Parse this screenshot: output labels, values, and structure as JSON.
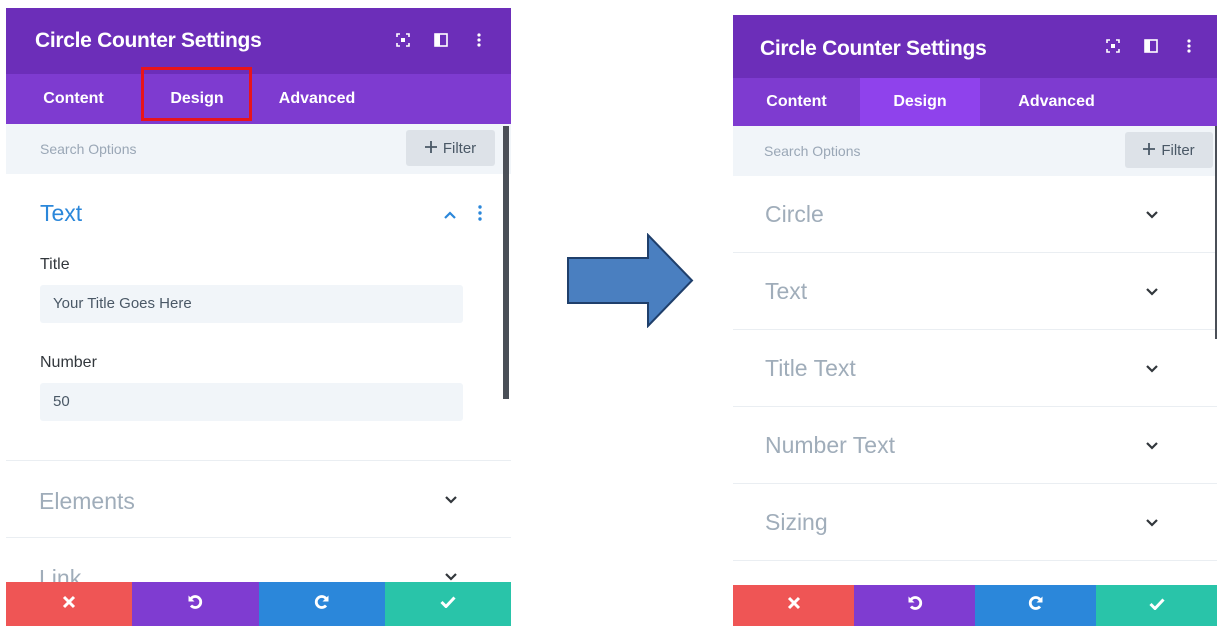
{
  "left_panel": {
    "title": "Circle Counter Settings",
    "header_icons": [
      "focus-icon",
      "columns-icon",
      "more-vertical-icon"
    ],
    "tabs": [
      {
        "label": "Content",
        "active": true
      },
      {
        "label": "Design",
        "active": false,
        "highlighted": true
      },
      {
        "label": "Advanced",
        "active": false
      }
    ],
    "search": {
      "placeholder": "Search Options",
      "filter_label": "Filter"
    },
    "open_section": {
      "label": "Text",
      "fields": [
        {
          "label": "Title",
          "value": "Your Title Goes Here"
        },
        {
          "label": "Number",
          "value": "50"
        }
      ]
    },
    "sections": [
      {
        "label": "Elements"
      },
      {
        "label": "Link"
      }
    ]
  },
  "right_panel": {
    "title": "Circle Counter Settings",
    "header_icons": [
      "focus-icon",
      "columns-icon",
      "more-vertical-icon"
    ],
    "tabs": [
      {
        "label": "Content",
        "active": false
      },
      {
        "label": "Design",
        "active": true
      },
      {
        "label": "Advanced",
        "active": false
      }
    ],
    "search": {
      "placeholder": "Search Options",
      "filter_label": "Filter"
    },
    "sections": [
      {
        "label": "Circle"
      },
      {
        "label": "Text"
      },
      {
        "label": "Title Text"
      },
      {
        "label": "Number Text"
      },
      {
        "label": "Sizing"
      }
    ]
  },
  "footer_icons": [
    "close-icon",
    "undo-icon",
    "redo-icon",
    "check-icon"
  ],
  "colors": {
    "header": "#6c2eb9",
    "tabs": "#7e3bd0",
    "active_tab": "#8f42ec",
    "accent_blue": "#2b87da",
    "discard": "#ef5555",
    "undo": "#7f3cd1",
    "redo": "#2b87da",
    "save": "#29c4a9",
    "highlight": "#e8141b",
    "arrow": "#4a7fc0"
  }
}
